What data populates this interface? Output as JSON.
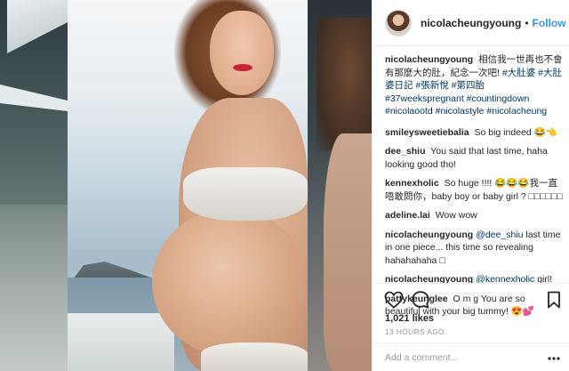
{
  "post": {
    "username": "nicolacheungyoung",
    "separator": "•",
    "follow_label": "Follow"
  },
  "caption": {
    "user": "nicolacheungyoung",
    "text": "相信我一世再也不會有那麼大的肚，紀念一次吧! ",
    "hashtags": "#大肚婆 #大肚婆日記 #張新悅 #第四胎 #37weekspregnant #countingdown #nicolaootd #nicolastyle #nicolacheung"
  },
  "comments": [
    {
      "user": "smileysweetiebalia",
      "text": "So big indeed 😂👈"
    },
    {
      "user": "dee_shiu",
      "text": "You said that last time, haha looking good tho!"
    },
    {
      "user": "kennexholic",
      "text": "So huge !!!! 😂😂😂我一直唔敢問你，baby boy or baby girl ? □□□□□□"
    },
    {
      "user": "adeline.lai",
      "text": "Wow wow"
    },
    {
      "user": "nicolacheungyoung",
      "mention": "@dee_shiu",
      "text": " last time in one piece... this time so revealing hahahahaha □"
    },
    {
      "user": "nicolacheungyoung",
      "mention": "@kennexholic",
      "text": " girl!"
    },
    {
      "user": "pattykeunglee",
      "text": "O m g You are so beautiful with your big tummy! 😍💕"
    }
  ],
  "stats": {
    "likes": "1,021 likes",
    "time": "13 HOURS AGO"
  },
  "compose": {
    "placeholder": "Add a comment..."
  },
  "icons": [
    "heart-icon",
    "comment-icon",
    "bookmark-icon",
    "more-options-icon"
  ],
  "colors": {
    "accent": "#3897f0",
    "hashtag": "#003569",
    "muted": "#999999",
    "border": "#efefef"
  }
}
